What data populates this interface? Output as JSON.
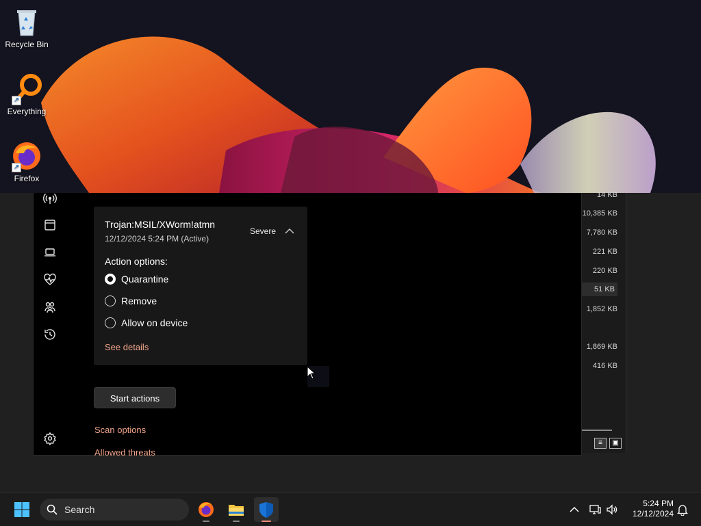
{
  "desktop": {
    "icons": [
      {
        "label": "Recycle Bin",
        "icon": "recycle-bin-icon"
      },
      {
        "label": "Everything",
        "icon": "everything-search-icon"
      },
      {
        "label": "Firefox",
        "icon": "firefox-icon"
      }
    ]
  },
  "explorer": {
    "sizes": [
      "14 KB",
      "10,385 KB",
      "7,780 KB",
      "221 KB",
      "220 KB",
      "51 KB",
      "1,852 KB",
      "1,869 KB",
      "416 KB"
    ],
    "selected_size": "51 KB"
  },
  "defender": {
    "nav_icons": [
      "antenna-icon",
      "app-browser-icon",
      "device-icon",
      "health-icon",
      "family-icon",
      "history-icon",
      "settings-icon"
    ],
    "threat": {
      "name": "Trojan:MSIL/XWorm!atmn",
      "date": "12/12/2024 5:24 PM (Active)",
      "severity": "Severe",
      "action_label": "Action options:",
      "options": [
        {
          "label": "Quarantine",
          "selected": true
        },
        {
          "label": "Remove",
          "selected": false
        },
        {
          "label": "Allow on device",
          "selected": false
        }
      ],
      "details_link": "See details"
    },
    "start_button": "Start actions",
    "scan_options_link": "Scan options",
    "allowed_threats_link": "Allowed threats",
    "accent_link_color": "#f0a48a"
  },
  "taskbar": {
    "search_placeholder": "Search",
    "apps": [
      "firefox-icon",
      "file-explorer-icon",
      "windows-security-icon"
    ],
    "active_app": "windows-security-icon",
    "time": "5:24 PM",
    "date": "12/12/2024"
  }
}
